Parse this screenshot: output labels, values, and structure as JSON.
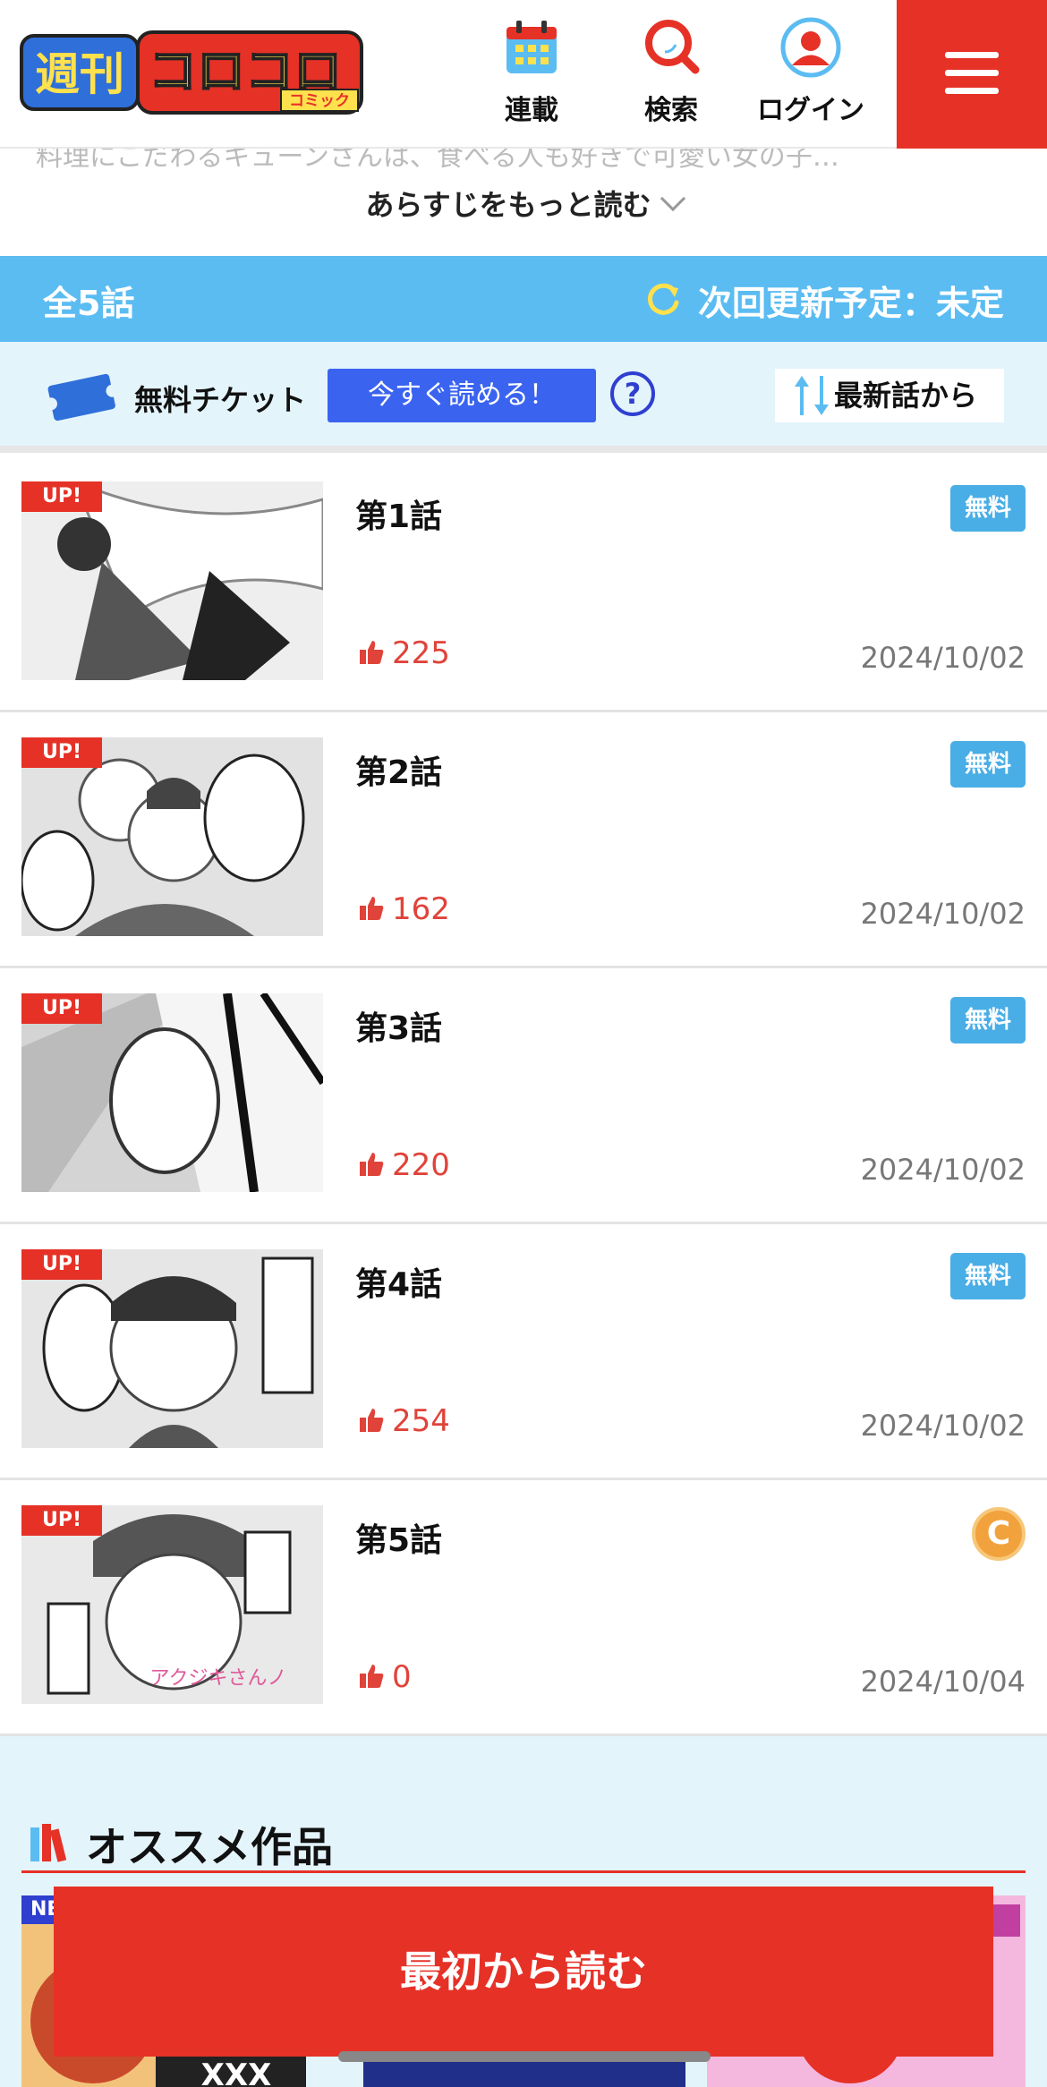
{
  "header": {
    "logo_text": "週刊コロコロコミック",
    "nav": [
      {
        "label": "連載",
        "icon": "calendar-icon"
      },
      {
        "label": "検索",
        "icon": "search-icon"
      },
      {
        "label": "ログイン",
        "icon": "user-icon"
      }
    ],
    "menu_icon": "hamburger-icon"
  },
  "synopsis": {
    "faded_text": "料理にこだわるキューンさんは、食べる人も好きで可愛い女の子…",
    "read_more_label": "あらすじをもっと読む"
  },
  "episode_bar": {
    "total_label": "全5話",
    "next_update_label": "次回更新予定：未定"
  },
  "ticket_bar": {
    "ticket_label": "無料チケット",
    "read_now_label": "今すぐ読める！",
    "help_label": "?",
    "sort_label": "最新話から"
  },
  "episodes": [
    {
      "title": "第1話",
      "up_badge": "UP!",
      "status": "無料",
      "status_type": "free",
      "likes": "225",
      "date": "2024/10/02"
    },
    {
      "title": "第2話",
      "up_badge": "UP!",
      "status": "無料",
      "status_type": "free",
      "likes": "162",
      "date": "2024/10/02"
    },
    {
      "title": "第3話",
      "up_badge": "UP!",
      "status": "無料",
      "status_type": "free",
      "likes": "220",
      "date": "2024/10/02"
    },
    {
      "title": "第4話",
      "up_badge": "UP!",
      "status": "無料",
      "status_type": "free",
      "likes": "254",
      "date": "2024/10/02"
    },
    {
      "title": "第5話",
      "up_badge": "UP!",
      "status": "C",
      "status_type": "coin",
      "likes": "0",
      "date": "2024/10/04"
    }
  ],
  "recommended": {
    "title": "オススメ作品",
    "first_badge": "NE"
  },
  "cta": {
    "label": "最初から読む"
  },
  "colors": {
    "brand_red": "#e63127",
    "episode_bar_blue": "#5bbcf2",
    "free_badge_blue": "#4aaee6",
    "read_now_blue": "#3a63f0",
    "light_bg": "#e3f4fb"
  }
}
